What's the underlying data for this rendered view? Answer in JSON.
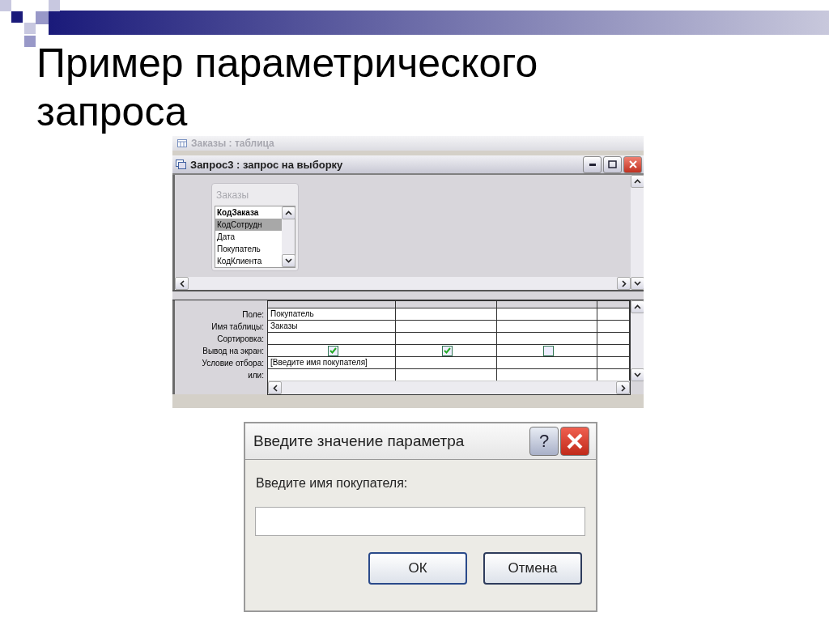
{
  "slide": {
    "title_lines": [
      "Пример параметрического",
      "запроса"
    ]
  },
  "background_window": {
    "title": "Заказы : таблица"
  },
  "query_window": {
    "title": "Запрос3 : запрос на выборку",
    "table_list": {
      "title": "Заказы",
      "fields": [
        {
          "label": "КодЗаказа",
          "kind": "key",
          "selected": false
        },
        {
          "label": "КодСотрудн",
          "kind": "field",
          "selected": true
        },
        {
          "label": "Дата",
          "kind": "field",
          "selected": false
        },
        {
          "label": "Покупатель",
          "kind": "field",
          "selected": false
        },
        {
          "label": "КодКлиента",
          "kind": "field",
          "selected": false
        }
      ]
    },
    "grid": {
      "row_labels": [
        "Поле:",
        "Имя таблицы:",
        "Сортировка:",
        "Вывод на экран:",
        "Условие отбора:",
        "или:"
      ],
      "columns": [
        {
          "field": "Покупатель",
          "table": "Заказы",
          "show": true,
          "criteria": "[Введите имя покупателя]"
        },
        {
          "show": true
        },
        {
          "show": false
        }
      ]
    }
  },
  "dialog": {
    "title": "Введите значение параметра",
    "help": "?",
    "prompt": "Введите имя покупателя:",
    "buttons": [
      "ОК",
      "Отмена"
    ]
  }
}
